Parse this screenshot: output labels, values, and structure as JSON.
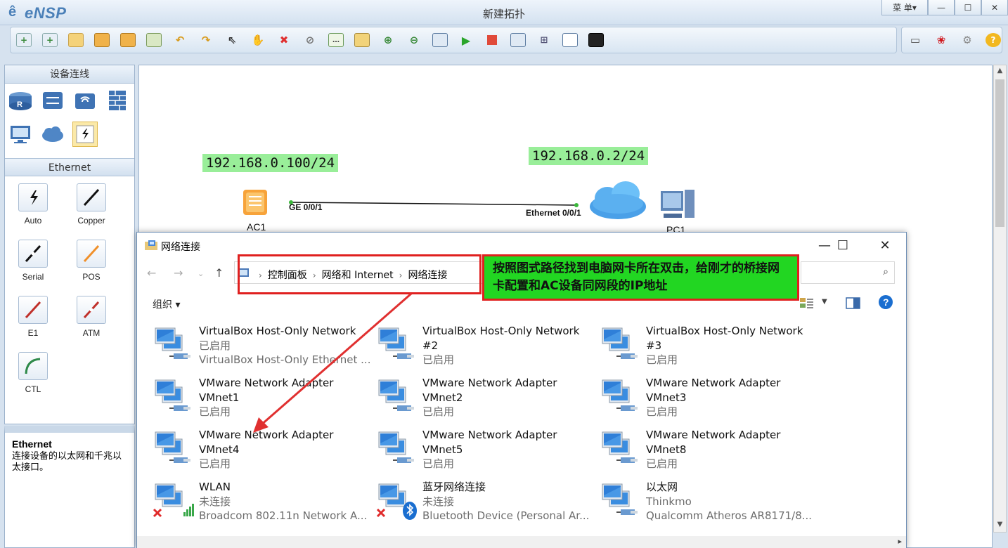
{
  "app": {
    "logo": "eNSP",
    "title": "新建拓扑",
    "menu_label": "菜 单▾",
    "minimize": "—",
    "maximize": "☐",
    "close": "✕"
  },
  "toolbar": {
    "icons": [
      "new-topology-icon",
      "new-example-icon",
      "open-icon",
      "save-icon",
      "save-as-icon",
      "print-icon",
      "undo-icon",
      "redo-icon",
      "select-icon",
      "pan-hand-icon",
      "delete-icon",
      "delete-link-icon",
      "text-note-icon",
      "palette-icon",
      "zoom-in-icon",
      "zoom-out-icon",
      "fit-icon",
      "start-icon",
      "stop-icon",
      "capture-icon",
      "topology-icon",
      "grid-icon",
      "console-icon"
    ],
    "right_icons": [
      "chat-icon",
      "huawei-icon",
      "settings-icon",
      "help-icon"
    ]
  },
  "left_panel": {
    "header": "设备连线",
    "devices": [
      "router-icon",
      "switch-icon",
      "wireless-icon",
      "firewall-icon",
      "pc-icon",
      "cloud-icon",
      "cable-icon"
    ],
    "ethernet_header": "Ethernet",
    "cables": [
      {
        "label": "Auto",
        "color": "#111111"
      },
      {
        "label": "Copper",
        "color": "#111111"
      },
      {
        "label": "Serial",
        "color": "#111111"
      },
      {
        "label": "POS",
        "color": "#f0902a"
      },
      {
        "label": "E1",
        "color": "#c0302a"
      },
      {
        "label": "ATM",
        "color": "#c0302a"
      },
      {
        "label": "CTL",
        "color": "#2f8a4a"
      }
    ],
    "desc_title": "Ethernet",
    "desc_text": "连接设备的以太网和千兆以太接口。"
  },
  "topology": {
    "ip_ac": "192.168.0.100/24",
    "ip_pc": "192.168.0.2/24",
    "port_ac": "GE 0/0/1",
    "port_cloud": "Ethernet 0/0/1",
    "node_ac": "AC1",
    "node_pc": "PC1"
  },
  "net_window": {
    "title": "网络连接",
    "breadcrumb": [
      "控制面板",
      "网络和 Internet",
      "网络连接"
    ],
    "organize": "组织 ▾",
    "items": [
      {
        "name": "VirtualBox Host-Only Network",
        "line2": "已启用",
        "line3": "VirtualBox Host-Only Ethernet ..."
      },
      {
        "name": "VirtualBox Host-Only Network",
        "line2": "#2",
        "line3": "已启用"
      },
      {
        "name": "VirtualBox Host-Only Network",
        "line2": "#3",
        "line3": "已启用"
      },
      {
        "name": "VMware Network Adapter",
        "line2": "VMnet1",
        "line3": "已启用"
      },
      {
        "name": "VMware Network Adapter",
        "line2": "VMnet2",
        "line3": "已启用"
      },
      {
        "name": "VMware Network Adapter",
        "line2": "VMnet3",
        "line3": "已启用"
      },
      {
        "name": "VMware Network Adapter",
        "line2": "VMnet4",
        "line3": "已启用"
      },
      {
        "name": "VMware Network Adapter",
        "line2": "VMnet5",
        "line3": "已启用"
      },
      {
        "name": "VMware Network Adapter",
        "line2": "VMnet8",
        "line3": "已启用"
      },
      {
        "name": "WLAN",
        "line2": "未连接",
        "line3": "Broadcom 802.11n Network A..."
      },
      {
        "name": "蓝牙网络连接",
        "line2": "未连接",
        "line3": "Bluetooth Device (Personal Ar..."
      },
      {
        "name": "以太网",
        "line2": "Thinkmo",
        "line3": "Qualcomm Atheros AR8171/8..."
      }
    ]
  },
  "annotation": {
    "callout": "按照图式路径找到电脑网卡所在双击，给刚才的桥接网卡配置和AC设备同网段的IP地址"
  }
}
